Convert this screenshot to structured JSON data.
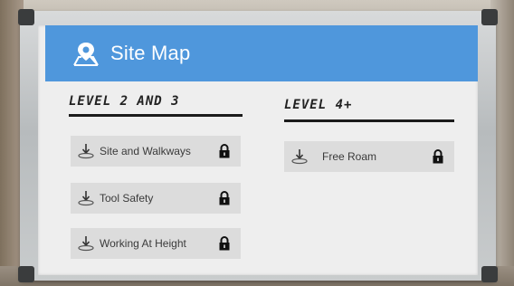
{
  "app": {
    "title": "Site Map",
    "header_icon": "map-pin-icon"
  },
  "sections": [
    {
      "title": "LEVEL 2 AND 3",
      "items": [
        {
          "label": "Site and Walkways",
          "icon": "download-icon",
          "status_icon": "lock-icon"
        },
        {
          "label": "Tool Safety",
          "icon": "download-icon",
          "status_icon": "lock-icon"
        },
        {
          "label": "Working At Height",
          "icon": "download-icon",
          "status_icon": "lock-icon"
        }
      ]
    },
    {
      "title": "LEVEL 4+",
      "items": [
        {
          "label": "Free Roam",
          "icon": "download-icon",
          "status_icon": "lock-icon"
        }
      ]
    }
  ],
  "colors": {
    "header": "#4f97dc",
    "panel": "#eeeeee",
    "item": "#dcdcdc"
  }
}
